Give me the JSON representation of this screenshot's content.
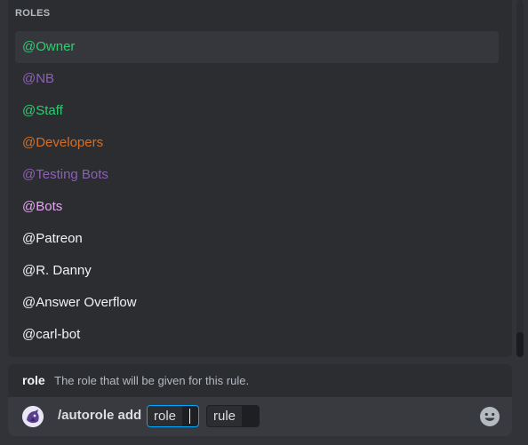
{
  "roles_popup": {
    "header": "ROLES",
    "items": [
      {
        "label": "@Owner",
        "color": "#2ecc71",
        "selected": true
      },
      {
        "label": "@NB",
        "color": "#8e5fb8"
      },
      {
        "label": "@Staff",
        "color": "#2ecc71"
      },
      {
        "label": "@Developers",
        "color": "#d46f2a"
      },
      {
        "label": "@Testing Bots",
        "color": "#8e5fb8"
      },
      {
        "label": "@Bots",
        "color": "#e6a5f5"
      },
      {
        "label": "@Patreon",
        "color": "#f2f3f5"
      },
      {
        "label": "@R. Danny",
        "color": "#f2f3f5"
      },
      {
        "label": "@Answer Overflow",
        "color": "#f2f3f5"
      },
      {
        "label": "@carl-bot",
        "color": "#f2f3f5"
      }
    ]
  },
  "hint": {
    "option_name": "role",
    "description": "The role that will be given for this rule."
  },
  "input": {
    "command": "/autorole add",
    "options": [
      "role",
      "rule"
    ],
    "active_option": "role"
  },
  "icons": {
    "avatar": "bot-avatar",
    "emoji": "emoji-smile-icon"
  },
  "colors": {
    "accent": "#00a8fc",
    "background": "#313338"
  }
}
